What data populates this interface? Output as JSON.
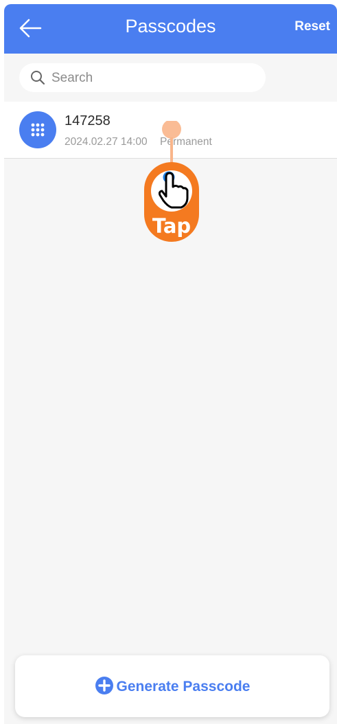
{
  "header": {
    "title": "Passcodes",
    "reset_label": "Reset",
    "back_icon": "arrow-left-icon"
  },
  "search": {
    "placeholder": "Search",
    "icon": "search-icon"
  },
  "passcodes": [
    {
      "code": "147258",
      "date": "2024.02.27 14:00",
      "type": "Permanent",
      "icon": "keypad-icon"
    }
  ],
  "tap_hint": {
    "label": "Tap",
    "icon": "hand-pointer-icon"
  },
  "footer": {
    "generate_label": "Generate Passcode",
    "icon": "plus-circle-icon"
  },
  "colors": {
    "accent": "#4a7ef0",
    "tap_hint": "#f47a20"
  }
}
